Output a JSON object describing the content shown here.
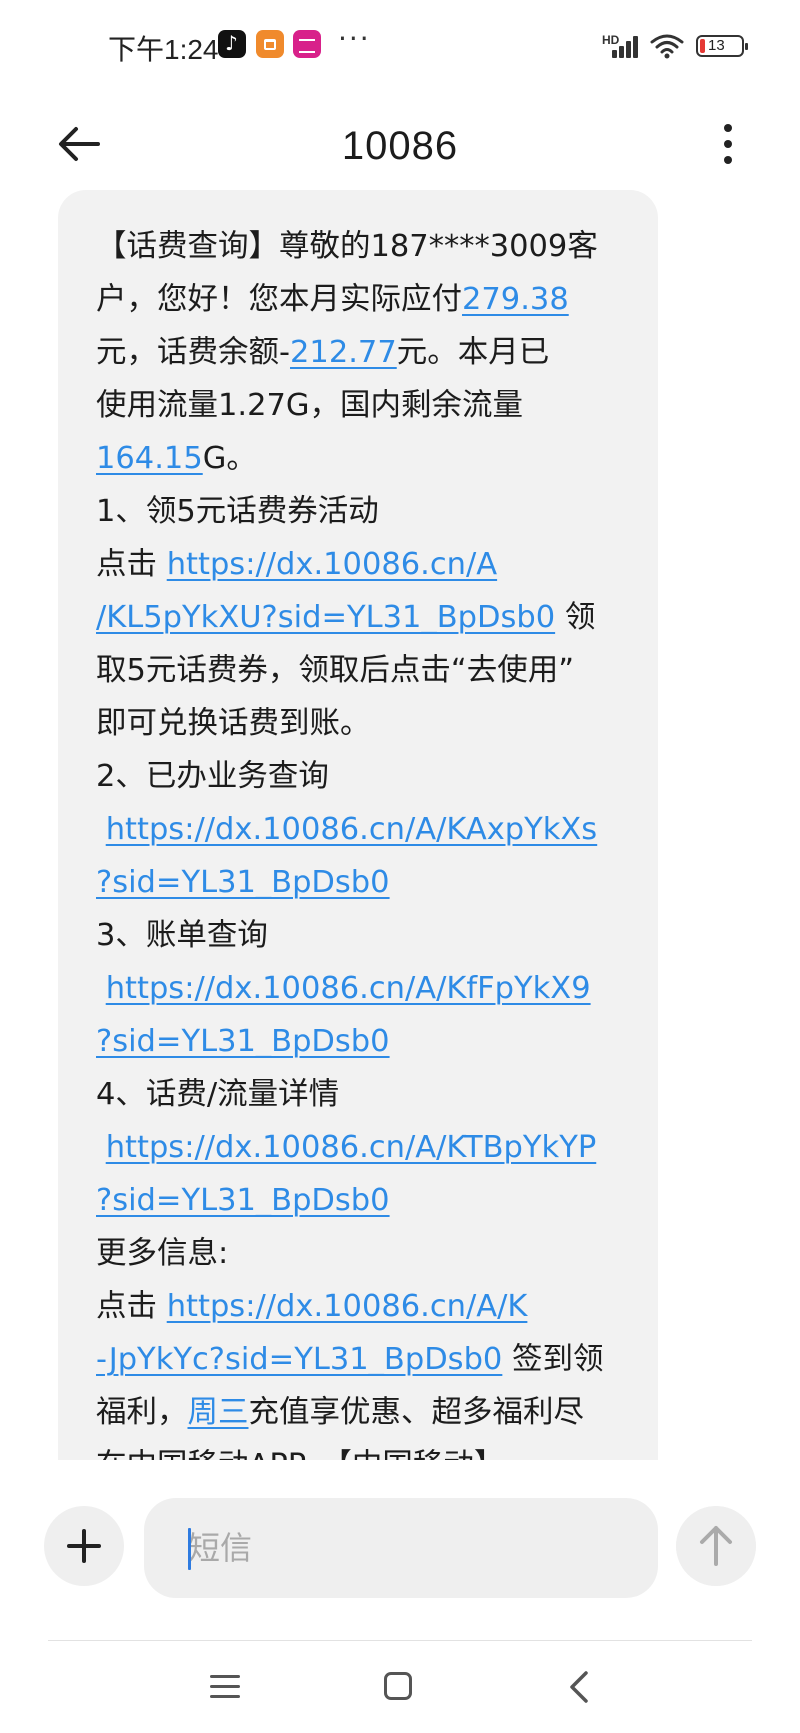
{
  "status_bar": {
    "time": "下午1:24",
    "more": "···",
    "network_label": "HD",
    "battery_level": "13",
    "icons": [
      "tiktok-icon",
      "shopping-app-icon",
      "pink-app-icon",
      "signal-icon",
      "wifi-icon",
      "battery-icon"
    ]
  },
  "header": {
    "title": "10086",
    "back_icon": "arrow-left-icon",
    "menu_icon": "more-vertical-icon"
  },
  "message": {
    "segments": {
      "s1": "【话费查询】尊敬的187****3009客",
      "s2": "户，您好！您本月实际应付",
      "s2_link": "279.38",
      "s3": "元，话费余额-",
      "s3_link": "212.77",
      "s3_end": "元。本月已",
      "s4": "使用流量1.27G，国内剩余流量",
      "s5_link": "164.15",
      "s5_end": "G。",
      "s6": "1、领5元话费券活动",
      "s7": "点击 ",
      "s7_link": "https://dx.10086.cn/A",
      "s8_link": "/KL5pYkXU?sid=YL31_BpDsb0",
      "s8_end": " 领",
      "s9": "取5元话费券，领取后点击“去使用”",
      "s10": "即可兑换话费到账。",
      "s11": "2、已办业务查询",
      "s12_link": "https://dx.10086.cn/A/KAxpYkXs",
      "s13_link": "?sid=YL31_BpDsb0",
      "s14": "3、账单查询",
      "s15_link": "https://dx.10086.cn/A/KfFpYkX9",
      "s16_link": "?sid=YL31_BpDsb0",
      "s17": "4、话费/流量详情",
      "s18_link": "https://dx.10086.cn/A/KTBpYkYP",
      "s19_link": "?sid=YL31_BpDsb0",
      "s20": "更多信息:",
      "s21": "点击 ",
      "s21_link": "https://dx.10086.cn/A/K",
      "s22_link": "-JpYkYc?sid=YL31_BpDsb0",
      "s22_end": " 签到领",
      "s23": "福利，",
      "s23_link": "周三",
      "s23_end": "充值享优惠、超多福利尽",
      "s24": "在中国移动APP。【中国移动】"
    }
  },
  "composer": {
    "placeholder": "短信",
    "value": "",
    "add_icon": "plus-icon",
    "send_icon": "arrow-up-icon"
  },
  "nav_bar": {
    "icons": [
      "menu-icon",
      "home-square-icon",
      "back-chevron-icon"
    ]
  },
  "colors": {
    "link": "#2e8be6",
    "bubble": "#f2f2f2",
    "caret": "#2e7be0",
    "battery_low": "#e53935"
  }
}
